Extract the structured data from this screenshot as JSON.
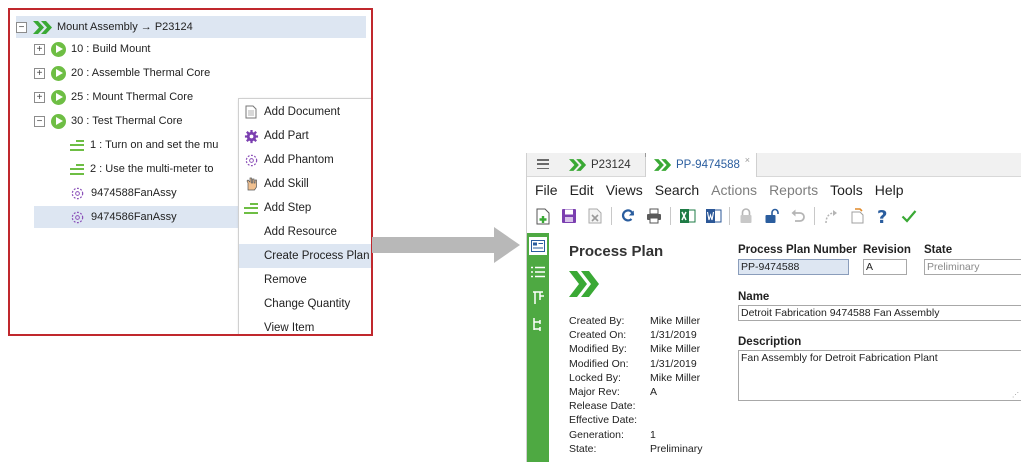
{
  "tree": {
    "root": {
      "label": "Mount Assembly → P23124",
      "expander": "−"
    },
    "operations": [
      {
        "label": "10 : Build Mount",
        "expander": "+"
      },
      {
        "label": "20 : Assemble Thermal Core",
        "expander": "+"
      },
      {
        "label": "25 : Mount Thermal Core",
        "expander": "+"
      },
      {
        "label": "30 : Test Thermal Core",
        "expander": "−"
      }
    ],
    "children": [
      {
        "label": "1 : Turn on and set the mu",
        "icon": "step-icon"
      },
      {
        "label": "2 : Use the multi-meter to",
        "icon": "step-icon"
      },
      {
        "label": "9474588FanAssy",
        "icon": "phantom-icon"
      },
      {
        "label": "9474586FanAssy",
        "icon": "phantom-icon"
      }
    ]
  },
  "context_menu": {
    "items": [
      {
        "label": "Add Document",
        "icon": "document-icon"
      },
      {
        "label": "Add Part",
        "icon": "part-gear-icon"
      },
      {
        "label": "Add Phantom",
        "icon": "phantom-gear-icon"
      },
      {
        "label": "Add Skill",
        "icon": "skill-hand-icon"
      },
      {
        "label": "Add Step",
        "icon": "step-icon"
      },
      {
        "label": "Add Resource",
        "icon": ""
      },
      {
        "label": "Create Process Plan",
        "icon": ""
      },
      {
        "label": "Remove",
        "icon": ""
      },
      {
        "label": "Change Quantity",
        "icon": ""
      },
      {
        "label": "View Item",
        "icon": ""
      }
    ],
    "highlighted": "Create Process Plan"
  },
  "app": {
    "tabs": [
      {
        "label": "P23124"
      },
      {
        "label": "PP-9474588",
        "close": "×"
      }
    ],
    "menu": [
      "File",
      "Edit",
      "Views",
      "Search",
      "Actions",
      "Reports",
      "Tools",
      "Help"
    ],
    "menu_disabled": [
      "Actions",
      "Reports"
    ],
    "toolbar_icons": [
      "new-icon",
      "save-icon",
      "discard-icon",
      "refresh-icon",
      "print-icon",
      "excel-export-icon",
      "word-export-icon",
      "lock-icon",
      "unlock-icon",
      "undo-icon",
      "promote-icon",
      "claim-icon",
      "help-icon",
      "done-check-icon"
    ],
    "side_icons": [
      "form-view-icon",
      "list-view-icon",
      "tree-view-icon",
      "structure-view-icon"
    ],
    "form": {
      "title": "Process Plan",
      "metadata": [
        {
          "key": "Created By:",
          "value": "Mike Miller"
        },
        {
          "key": "Created On:",
          "value": "1/31/2019"
        },
        {
          "key": "Modified By:",
          "value": "Mike Miller"
        },
        {
          "key": "Modified On:",
          "value": "1/31/2019"
        },
        {
          "key": "Locked By:",
          "value": "Mike Miller"
        },
        {
          "key": "Major Rev:",
          "value": "A"
        },
        {
          "key": "Release Date:",
          "value": ""
        },
        {
          "key": "Effective Date:",
          "value": ""
        },
        {
          "key": "Generation:",
          "value": "1"
        },
        {
          "key": "State:",
          "value": "Preliminary"
        }
      ],
      "number_label": "Process Plan Number",
      "number_value": "PP-9474588",
      "revision_label": "Revision",
      "revision_value": "A",
      "state_label": "State",
      "state_value": "Preliminary",
      "name_label": "Name",
      "name_value": "Detroit Fabrication 9474588 Fan Assembly",
      "description_label": "Description",
      "description_value": "Fan Assembly for Detroit Fabrication Plant"
    }
  },
  "colors": {
    "accent_green": "#6ebe44",
    "sidebar_green": "#4ea942",
    "highlight_blue": "#dde6f2",
    "frame_red": "#c0282d",
    "tab_blue": "#2a5d9e"
  }
}
